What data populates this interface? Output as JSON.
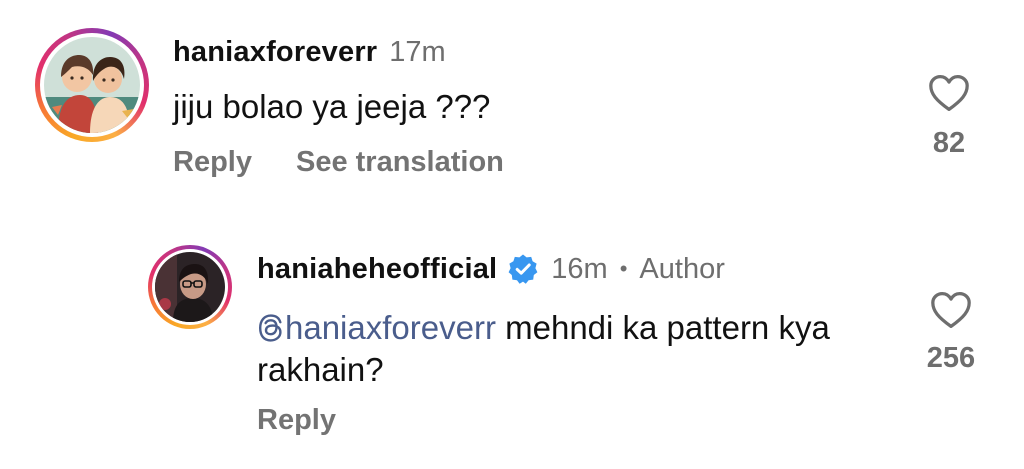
{
  "comments": [
    {
      "username": "haniaxforeverr",
      "time": "17m",
      "text": "jiju bolao ya jeeja ???",
      "actions": {
        "reply": "Reply",
        "translate": "See translation"
      },
      "likes": "82",
      "avatar_icon": "illustrated-couple-avatar",
      "like_icon": "heart-outline-icon"
    },
    {
      "username": "haniaheheofficial",
      "verified": true,
      "time": "16m",
      "separator": "•",
      "badge": "Author",
      "mention": "haniaxforeverr",
      "mention_icon": "threads-icon",
      "text": " mehndi ka pattern kya rakhain?",
      "actions": {
        "reply": "Reply"
      },
      "likes": "256",
      "avatar_icon": "portrait-photo-avatar",
      "like_icon": "heart-outline-icon"
    }
  ],
  "colors": {
    "verified_badge": "#3897f0",
    "mention": "#4a5d8c",
    "secondary_text": "#737373"
  }
}
